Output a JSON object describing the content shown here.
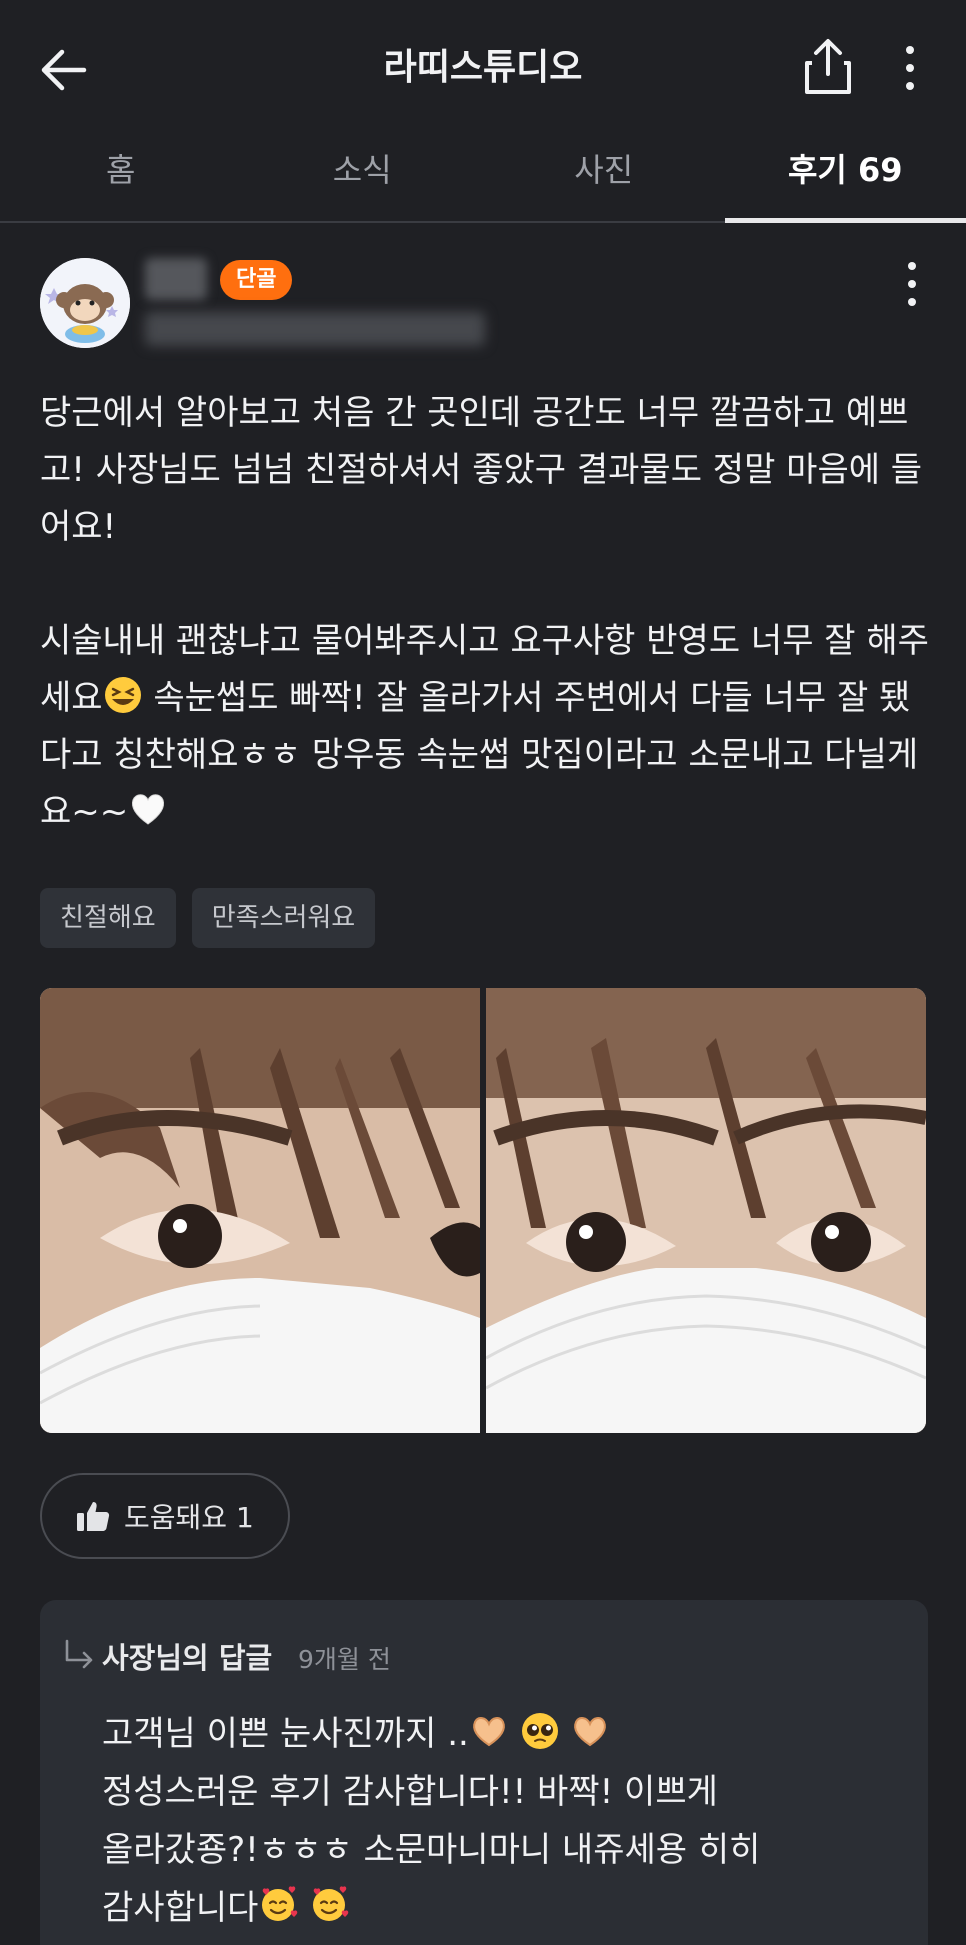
{
  "header": {
    "title": "라띠스튜디오",
    "back_icon": "arrow-left-icon",
    "share_icon": "share-icon",
    "more_icon": "more-vertical-icon"
  },
  "tabs": [
    {
      "label": "홈",
      "active": false
    },
    {
      "label": "소식",
      "active": false
    },
    {
      "label": "사진",
      "active": false
    },
    {
      "label": "후기 69",
      "active": true
    }
  ],
  "review": {
    "badge": "단골",
    "paragraph1": "당근에서 알아보고 처음 간 곳인데 공간도 너무 깔끔하고 예쁘고! 사장님도 넘넘 친절하셔서 좋았구 결과물도 정말 마음에 들어요!",
    "paragraph2_a": "시술내내 괜찮냐고 물어봐주시고 요구사항 반영도 너무 잘 해주세요",
    "paragraph2_b": " 속눈썹도 빠짝! 잘 올라가서 주변에서 다들 너무 잘 됐다고 칭찬해요ㅎㅎ 망우동 속눈썹 맛집이라고 소문내고 다닐게요~~",
    "tags": [
      "친절해요",
      "만족스러워요"
    ],
    "helpful_label": "도움돼요 1"
  },
  "reply": {
    "owner_label": "사장님의 답글",
    "time": "9개월 전",
    "line1": "고객님 이쁜 눈사진까지 ..",
    "line2": "정성스러운 후기 감사합니다!! 바짝! 이쁘게",
    "line3": "올라갔죵?!ㅎㅎㅎ 소문마니마니 내쥬세용 히히",
    "line4": "감사합니다"
  },
  "colors": {
    "background": "#1f2024",
    "badge": "#ff6f0f",
    "tag_bg": "#2f3238",
    "reply_bg": "#2b2e34"
  }
}
